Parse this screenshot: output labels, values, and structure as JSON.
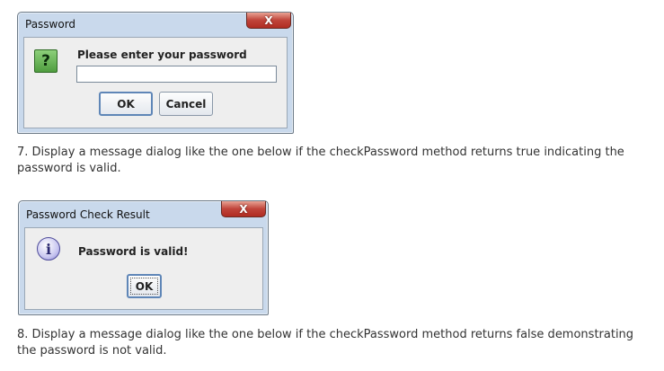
{
  "dialog1": {
    "title": "Password",
    "close_label": "X",
    "question_glyph": "?",
    "prompt": "Please enter your password",
    "password_value": "",
    "ok_label": "OK",
    "cancel_label": "Cancel",
    "icon": "question-icon"
  },
  "step7": {
    "text": "7. Display a message dialog like the one below if the checkPassword method returns true indicating the password is valid."
  },
  "dialog2": {
    "title": "Password Check Result",
    "close_label": "X",
    "info_glyph": "i",
    "message": "Password is valid!",
    "ok_label": "OK",
    "icon": "information-icon"
  },
  "step8": {
    "text": "8. Display a message dialog like the one below if the checkPassword method returns false demonstrating the password is not valid."
  },
  "colors": {
    "frame": "#c9d9ec",
    "body": "#eeeeee",
    "close_button": "#c0443a",
    "question_icon": "#4f9d3f",
    "info_icon": "#8a86d6"
  }
}
